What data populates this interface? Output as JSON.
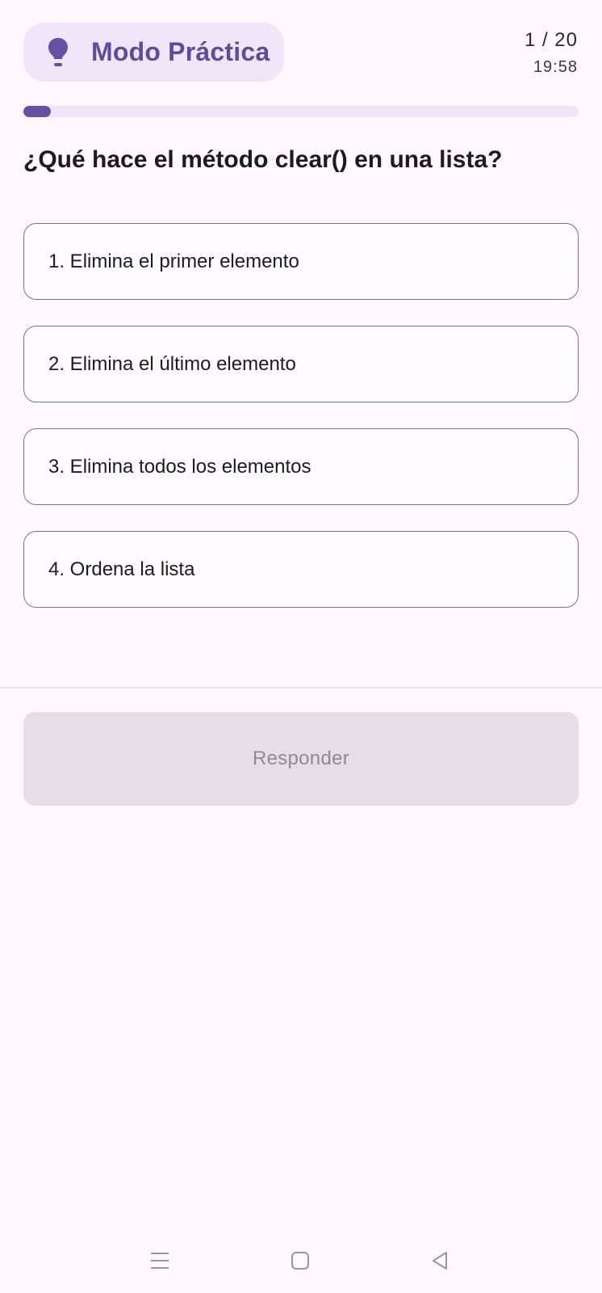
{
  "header": {
    "mode_label": "Modo Práctica",
    "mode_icon": "lightbulb-icon",
    "counter": "1 / 20",
    "timer": "19:58"
  },
  "progress": {
    "current": 1,
    "total": 20,
    "fraction": 0.05,
    "color": "#6650a4"
  },
  "question": {
    "text": "¿Qué hace el método clear() en una lista?"
  },
  "options": [
    {
      "label": "1. Elimina el primer elemento"
    },
    {
      "label": "2. Elimina el último elemento"
    },
    {
      "label": "3. Elimina todos los elementos"
    },
    {
      "label": "4. Ordena la lista"
    }
  ],
  "submit": {
    "label": "Responder",
    "enabled": false
  },
  "navbar": {
    "icons": [
      "menu-icon",
      "home-icon",
      "back-icon"
    ]
  },
  "colors": {
    "accent": "#6650a4",
    "accent_light": "#ede8f9",
    "background": "#fdf8fd"
  }
}
